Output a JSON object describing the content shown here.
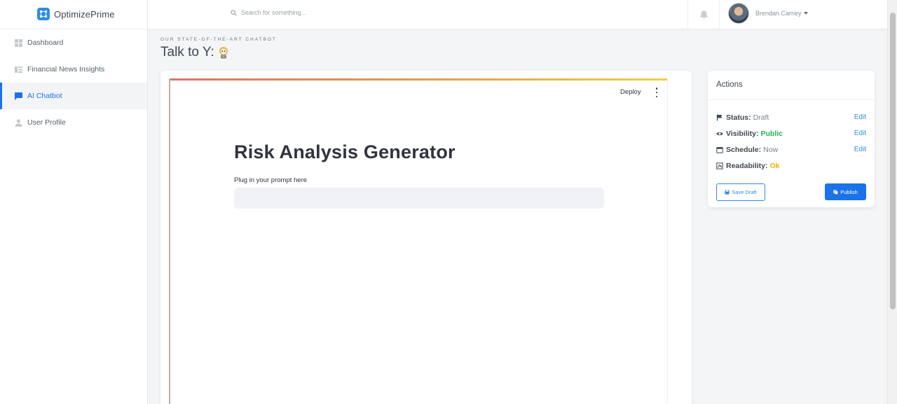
{
  "brand": {
    "name": "OptimizePrime",
    "logo_icon": "circuit-icon",
    "accent": "#2f8ce6"
  },
  "sidebar": {
    "items": [
      {
        "label": "Dashboard",
        "icon": "grid-icon",
        "active": false
      },
      {
        "label": "Financial News Insights",
        "icon": "news-icon",
        "active": false
      },
      {
        "label": "AI Chatbot",
        "icon": "chat-icon",
        "active": true
      },
      {
        "label": "User Profile",
        "icon": "person-icon",
        "active": false
      }
    ]
  },
  "topbar": {
    "search_placeholder": "Search for something...",
    "notification_icon": "bell-icon",
    "user_name": "Brendan Carney"
  },
  "page": {
    "eyebrow": "Our state-of-the-art chatbot",
    "title": "Talk to Y:"
  },
  "app": {
    "deploy_label": "Deploy",
    "title": "Risk Analysis Generator",
    "prompt_label": "Plug in your prompt here",
    "prompt_value": ""
  },
  "actions": {
    "title": "Actions",
    "rows": [
      {
        "label": "Status:",
        "value": "Draft",
        "edit": "Edit",
        "icon": "flag-icon"
      },
      {
        "label": "Visibility:",
        "value": "Public",
        "edit": "Edit",
        "icon": "eye-icon",
        "color": "#22b24c"
      },
      {
        "label": "Schedule:",
        "value": "Now",
        "edit": "Edit",
        "icon": "calendar-icon"
      },
      {
        "label": "Readability:",
        "value": "Ok",
        "icon": "readability-icon",
        "color": "#f0b400"
      }
    ],
    "save_draft_label": "Save Draft",
    "publish_label": "Publish"
  }
}
